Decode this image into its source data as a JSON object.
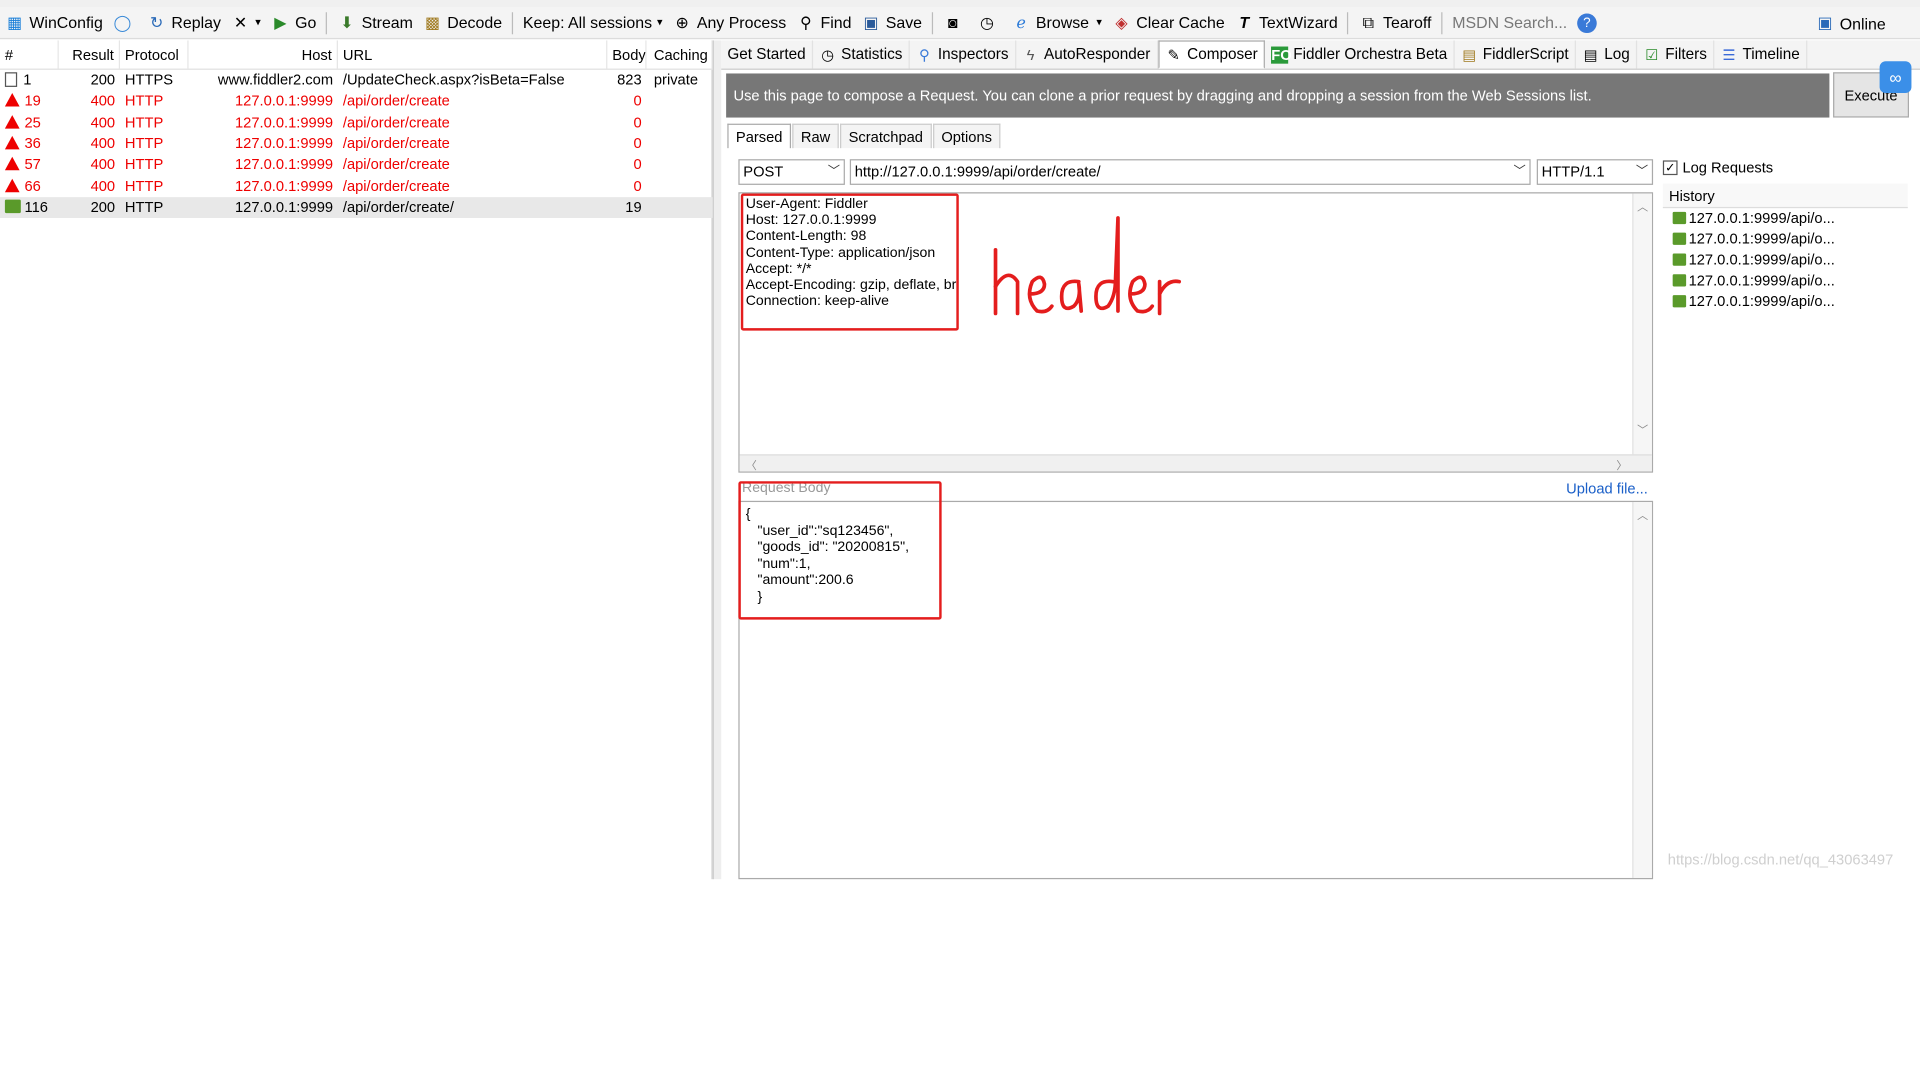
{
  "toolbar": {
    "winconfig": "WinConfig",
    "replay": "Replay",
    "go": "Go",
    "stream": "Stream",
    "decode": "Decode",
    "keep": "Keep: All sessions",
    "process": "Any Process",
    "find": "Find",
    "save": "Save",
    "browse": "Browse",
    "clear_cache": "Clear Cache",
    "textwizard": "TextWizard",
    "tearoff": "Tearoff",
    "msdn": "MSDN Search...",
    "online": "Online"
  },
  "sessions": {
    "columns": [
      "#",
      "Result",
      "Protocol",
      "Host",
      "URL",
      "Body",
      "Caching"
    ],
    "rows": [
      {
        "num": "1",
        "result": "200",
        "protocol": "HTTPS",
        "host": "www.fiddler2.com",
        "url": "/UpdateCheck.aspx?isBeta=False",
        "body": "823",
        "caching": "private",
        "state": "info"
      },
      {
        "num": "19",
        "result": "400",
        "protocol": "HTTP",
        "host": "127.0.0.1:9999",
        "url": "/api/order/create",
        "body": "0",
        "caching": "",
        "state": "error"
      },
      {
        "num": "25",
        "result": "400",
        "protocol": "HTTP",
        "host": "127.0.0.1:9999",
        "url": "/api/order/create",
        "body": "0",
        "caching": "",
        "state": "error"
      },
      {
        "num": "36",
        "result": "400",
        "protocol": "HTTP",
        "host": "127.0.0.1:9999",
        "url": "/api/order/create",
        "body": "0",
        "caching": "",
        "state": "error"
      },
      {
        "num": "57",
        "result": "400",
        "protocol": "HTTP",
        "host": "127.0.0.1:9999",
        "url": "/api/order/create",
        "body": "0",
        "caching": "",
        "state": "error"
      },
      {
        "num": "66",
        "result": "400",
        "protocol": "HTTP",
        "host": "127.0.0.1:9999",
        "url": "/api/order/create",
        "body": "0",
        "caching": "",
        "state": "error"
      },
      {
        "num": "116",
        "result": "200",
        "protocol": "HTTP",
        "host": "127.0.0.1:9999",
        "url": "/api/order/create/",
        "body": "19",
        "caching": "",
        "state": "ok"
      }
    ]
  },
  "tabs": [
    {
      "label": "Get Started",
      "icon": "none"
    },
    {
      "label": "Statistics",
      "icon": "stopwatch-icon"
    },
    {
      "label": "Inspectors",
      "icon": "inspect-icon"
    },
    {
      "label": "AutoResponder",
      "icon": "lightning-icon"
    },
    {
      "label": "Composer",
      "icon": "compose-icon",
      "active": true
    },
    {
      "label": "Fiddler Orchestra Beta",
      "icon": "fo-icon"
    },
    {
      "label": "FiddlerScript",
      "icon": "script-icon"
    },
    {
      "label": "Log",
      "icon": "log-icon"
    },
    {
      "label": "Filters",
      "icon": "checkbox-icon"
    },
    {
      "label": "Timeline",
      "icon": "timeline-icon"
    }
  ],
  "composer": {
    "banner": "Use this page to compose a Request. You can clone a prior request by dragging and dropping a session from the Web Sessions list.",
    "execute": "Execute",
    "subtabs": [
      "Parsed",
      "Raw",
      "Scratchpad",
      "Options"
    ],
    "method": "POST",
    "url": "http://127.0.0.1:9999/api/order/create/",
    "version": "HTTP/1.1",
    "log_requests": "Log Requests",
    "headers": "User-Agent: Fiddler\nHost: 127.0.0.1:9999\nContent-Length: 98\nContent-Type: application/json\nAccept: */*\nAccept-Encoding: gzip, deflate, br\nConnection: keep-alive",
    "request_body_label": "Request Body",
    "upload_file": "Upload file...",
    "body": "{\n   \"user_id\":\"sq123456\",\n   \"goods_id\": \"20200815\",\n   \"num\":1,\n   \"amount\":200.6\n   }"
  },
  "history": {
    "label": "History",
    "items": [
      "127.0.0.1:9999/api/o...",
      "127.0.0.1:9999/api/o...",
      "127.0.0.1:9999/api/o...",
      "127.0.0.1:9999/api/o...",
      "127.0.0.1:9999/api/o..."
    ]
  },
  "annotation": {
    "text": "header",
    "color": "#e41d1d"
  },
  "watermark": "https://blog.csdn.net/qq_43063497"
}
